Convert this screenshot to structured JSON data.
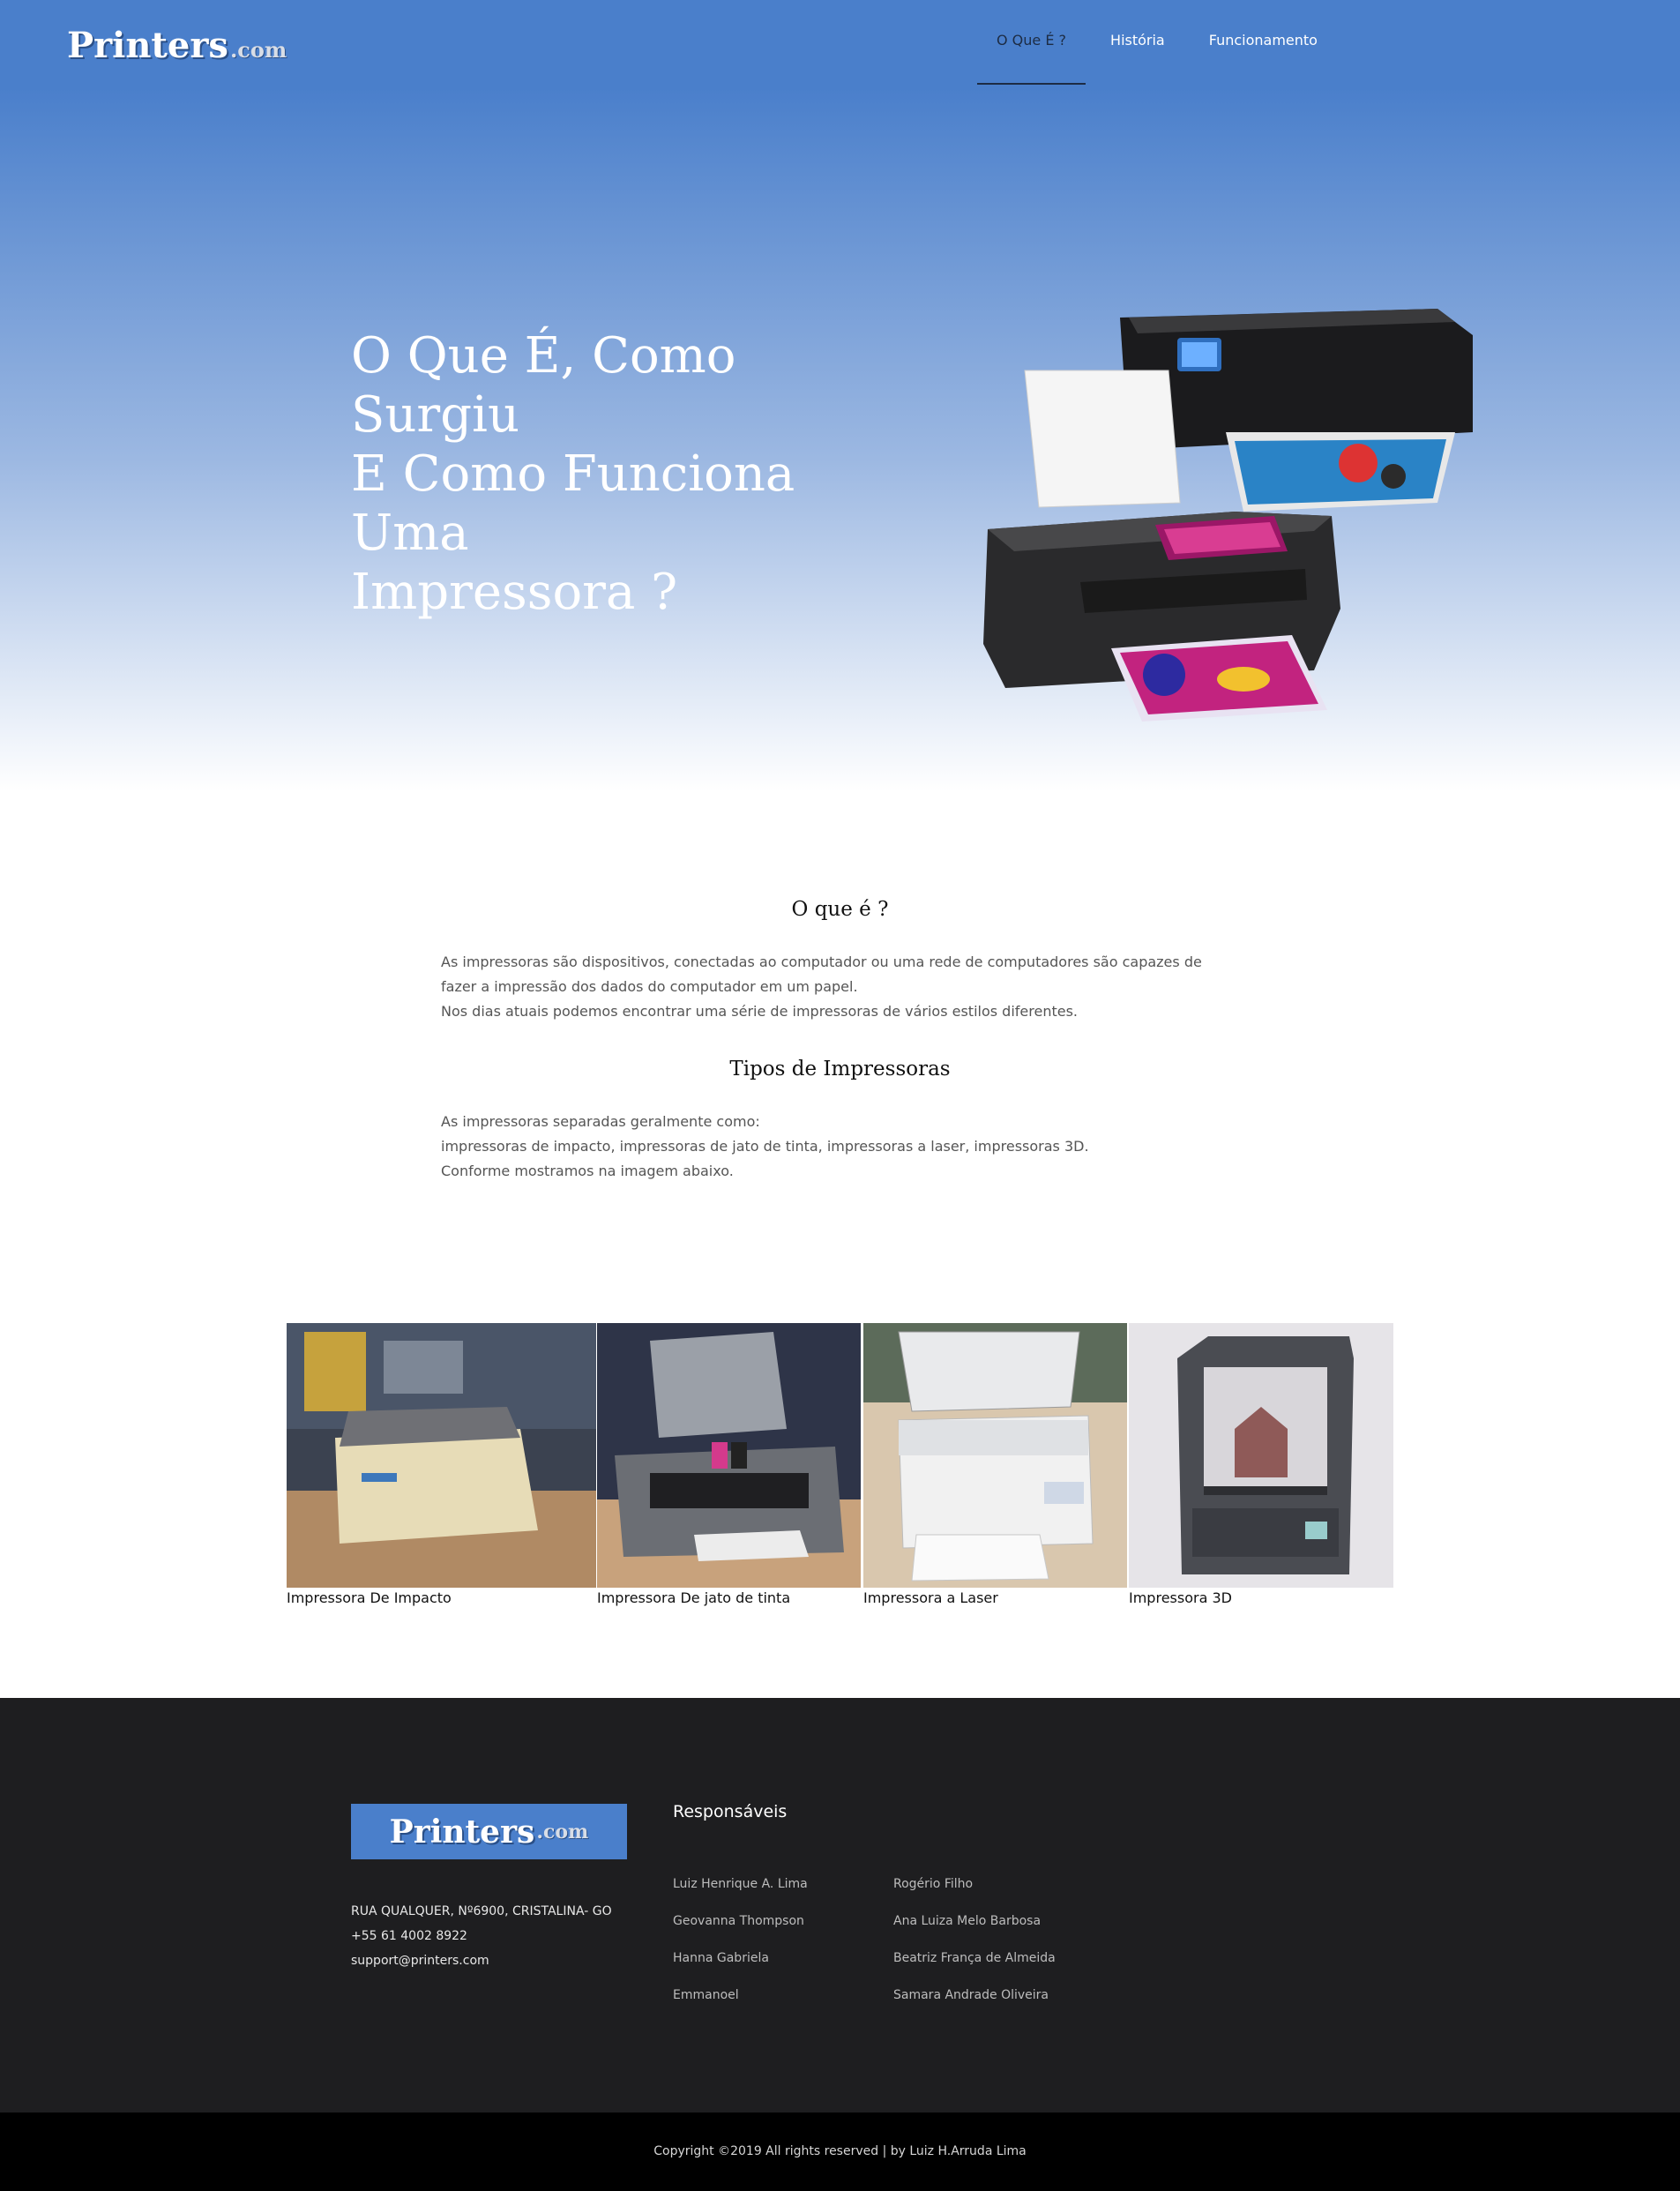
{
  "header": {
    "logo_main": "Printers",
    "logo_sub": ".com",
    "nav": [
      {
        "label": "O Que É ?",
        "active": true
      },
      {
        "label": "História",
        "active": false
      },
      {
        "label": "Funcionamento",
        "active": false
      }
    ]
  },
  "hero": {
    "title_lines": [
      "O Que É, Como Surgiu",
      "E Como Funciona Uma",
      "Impressora ?"
    ]
  },
  "about": {
    "heading": "O que é ?",
    "lines": [
      "As impressoras são dispositivos, conectadas ao computador ou uma rede de computadores são capazes de",
      "fazer a impressão dos dados do computador em um papel.",
      "Nos dias atuais podemos encontrar uma série de impressoras de vários estilos diferentes."
    ]
  },
  "types": {
    "heading": "Tipos de Impressoras",
    "lines": [
      "As impressoras separadas geralmente como:",
      "impressoras de impacto, impressoras de jato de tinta, impressoras a laser, impressoras 3D.",
      "Conforme mostramos na imagem abaixo."
    ]
  },
  "gallery": [
    {
      "caption": "Impressora De Impacto"
    },
    {
      "caption": "Impressora De jato de tinta"
    },
    {
      "caption": "Impressora a Laser"
    },
    {
      "caption": "Impressora 3D"
    }
  ],
  "footer": {
    "logo_main": "Printers",
    "logo_sub": ".com",
    "address": "RUA QUALQUER, Nº6900, CRISTALINA- GO",
    "phone": "+55 61 4002 8922",
    "email": "support@printers.com",
    "team_title": "Responsáveis",
    "team_col1": [
      "Luiz Henrique A. Lima",
      "Geovanna Thompson",
      "Hanna Gabriela",
      "Emmanoel"
    ],
    "team_col2": [
      "Rogério Filho",
      "Ana Luiza Melo Barbosa",
      "Beatriz França de Almeida",
      "Samara Andrade Oliveira"
    ],
    "copyright": "Copyright ©2019 All rights reserved | by Luiz H.Arruda Lima"
  }
}
